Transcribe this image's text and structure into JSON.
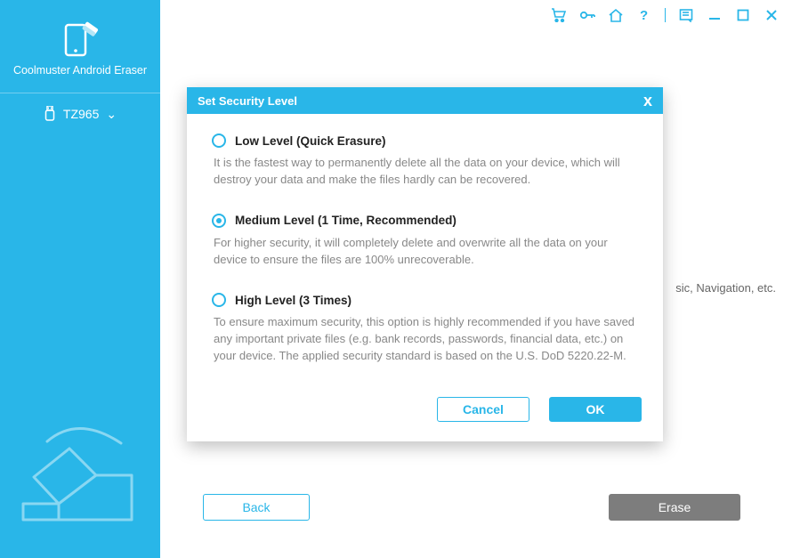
{
  "app": {
    "title": "Coolmuster Android Eraser"
  },
  "sidebar": {
    "device_name": "TZ965"
  },
  "background": {
    "partial_text": "sic, Navigation, etc."
  },
  "footer": {
    "back_label": "Back",
    "erase_label": "Erase"
  },
  "modal": {
    "title": "Set Security Level",
    "cancel_label": "Cancel",
    "ok_label": "OK",
    "selected_index": 1,
    "options": [
      {
        "title": "Low Level (Quick Erasure)",
        "desc": "It is the fastest way to permanently delete all the data on your device, which will destroy your data and make the files hardly can be recovered."
      },
      {
        "title": "Medium Level (1 Time, Recommended)",
        "desc": "For higher security, it will completely delete and overwrite all the data on your device to ensure the files are 100% unrecoverable."
      },
      {
        "title": "High Level (3 Times)",
        "desc": "To ensure maximum security, this option is highly recommended if you have saved any important private files (e.g. bank records, passwords, financial data, etc.) on your device. The applied security standard is based on the U.S. DoD 5220.22-M."
      }
    ]
  },
  "colors": {
    "accent": "#29b6e8"
  }
}
